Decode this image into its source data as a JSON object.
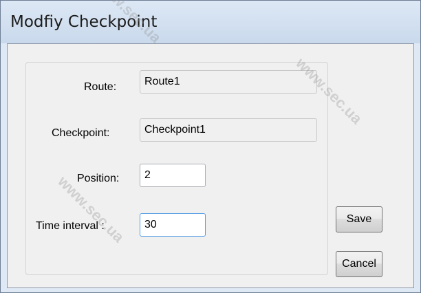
{
  "window": {
    "title": "Modfiy Checkpoint"
  },
  "form": {
    "route_label": "Route:",
    "route_value": "Route1",
    "checkpoint_label": "Checkpoint:",
    "checkpoint_value": "Checkpoint1",
    "position_label": "Position:",
    "position_value": "2",
    "time_interval_label": "Time interval :",
    "time_interval_value": "30"
  },
  "buttons": {
    "save_label": "Save",
    "cancel_label": "Cancel"
  },
  "watermarks": [
    "www.sec.ua",
    "www.sec.ua",
    "www.sec.ua"
  ]
}
